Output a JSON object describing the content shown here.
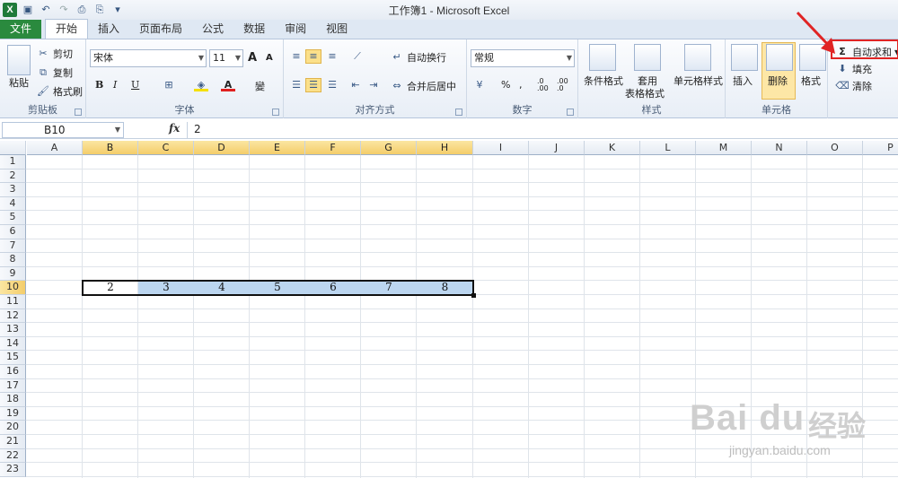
{
  "window": {
    "title": "工作簿1 - Microsoft Excel"
  },
  "tabs": [
    {
      "label": "文件"
    },
    {
      "label": "开始"
    },
    {
      "label": "插入"
    },
    {
      "label": "页面布局"
    },
    {
      "label": "公式"
    },
    {
      "label": "数据"
    },
    {
      "label": "审阅"
    },
    {
      "label": "视图"
    }
  ],
  "ribbon": {
    "clipboard": {
      "paste": "粘贴",
      "cut": "剪切",
      "copy": "复制",
      "format_painter": "格式刷",
      "label": "剪贴板"
    },
    "font": {
      "font_name": "宋体",
      "font_size": "11",
      "grow": "A",
      "shrink": "A",
      "bold": "B",
      "italic": "I",
      "underline": "U",
      "wen": "變",
      "label": "字体"
    },
    "alignment": {
      "wrap_text": "自动换行",
      "merge_center": "合并后居中",
      "label": "对齐方式"
    },
    "number": {
      "format": "常规",
      "percent": "%",
      "comma": ",",
      "inc_decimal": ".0 .00",
      "dec_decimal": ".00 .0",
      "label": "数字"
    },
    "styles": {
      "conditional": "条件格式",
      "table_top": "套用",
      "table_bottom": "表格格式",
      "cell_styles": "单元格样式",
      "label": "样式"
    },
    "cells": {
      "insert": "插入",
      "delete": "删除",
      "format": "格式",
      "label": "单元格"
    },
    "editing": {
      "autosum": "自动求和",
      "fill": "填充",
      "clear": "清除"
    }
  },
  "formula_bar": {
    "name_box": "B10",
    "fx": "fx",
    "value": "2"
  },
  "columns": [
    "A",
    "B",
    "C",
    "D",
    "E",
    "F",
    "G",
    "H",
    "I",
    "J",
    "K",
    "L",
    "M",
    "N",
    "O",
    "P"
  ],
  "rows": [
    "1",
    "2",
    "3",
    "4",
    "5",
    "6",
    "7",
    "8",
    "9",
    "10",
    "11",
    "12",
    "13",
    "14",
    "15",
    "16",
    "17",
    "18",
    "19",
    "20",
    "21",
    "22",
    "23"
  ],
  "row10_values": [
    "2",
    "3",
    "4",
    "5",
    "6",
    "7",
    "8"
  ],
  "watermark": {
    "brand": "Bai du",
    "cn": "经验",
    "url": "jingyan.baidu.com"
  },
  "colors": {
    "file_tab": "#2a8a3e",
    "selection_header": "#f4cd6a",
    "selected_cells": "#bcd6f0",
    "callout": "#e02424"
  }
}
